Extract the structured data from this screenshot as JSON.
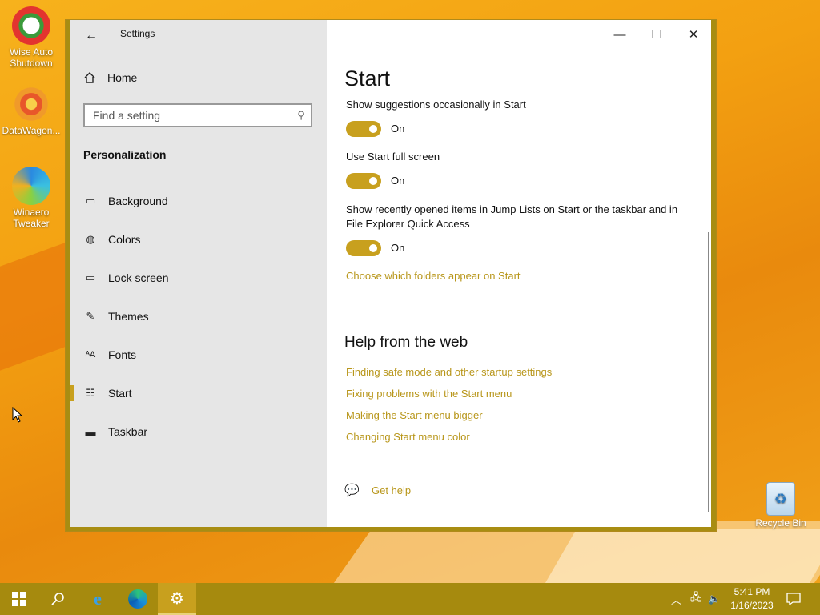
{
  "desktop": {
    "icons": [
      {
        "label": "Wise Auto Shutdown"
      },
      {
        "label": "DataWagon..."
      },
      {
        "label": "Winaero Tweaker"
      },
      {
        "label": "Recycle Bin"
      }
    ]
  },
  "window": {
    "title": "Settings",
    "controls": {
      "minimize": "—",
      "maximize": "☐",
      "close": "✕"
    }
  },
  "sidebar": {
    "home_label": "Home",
    "search_placeholder": "Find a setting",
    "section": "Personalization",
    "items": [
      {
        "label": "Background",
        "icon": "image-icon"
      },
      {
        "label": "Colors",
        "icon": "palette-icon"
      },
      {
        "label": "Lock screen",
        "icon": "lock-screen-icon"
      },
      {
        "label": "Themes",
        "icon": "themes-icon"
      },
      {
        "label": "Fonts",
        "icon": "fonts-icon"
      },
      {
        "label": "Start",
        "icon": "start-icon",
        "active": true
      },
      {
        "label": "Taskbar",
        "icon": "taskbar-icon"
      }
    ]
  },
  "main": {
    "title": "Start",
    "settings": [
      {
        "label": "Show suggestions occasionally in Start",
        "state": "On"
      },
      {
        "label": "Use Start full screen",
        "state": "On"
      },
      {
        "label": "Show recently opened items in Jump Lists on Start or the taskbar and in File Explorer Quick Access",
        "state": "On"
      }
    ],
    "folders_link": "Choose which folders appear on Start",
    "help_title": "Help from the web",
    "help_links": [
      "Finding safe mode and other startup settings",
      "Fixing problems with the Start menu",
      "Making the Start menu bigger",
      "Changing Start menu color"
    ],
    "get_help": "Get help"
  },
  "taskbar": {
    "time": "5:41 PM",
    "date": "1/16/2023"
  },
  "colors": {
    "accent": "#c8a01e",
    "link": "#b8961a",
    "taskbar": "#a68a0e"
  }
}
